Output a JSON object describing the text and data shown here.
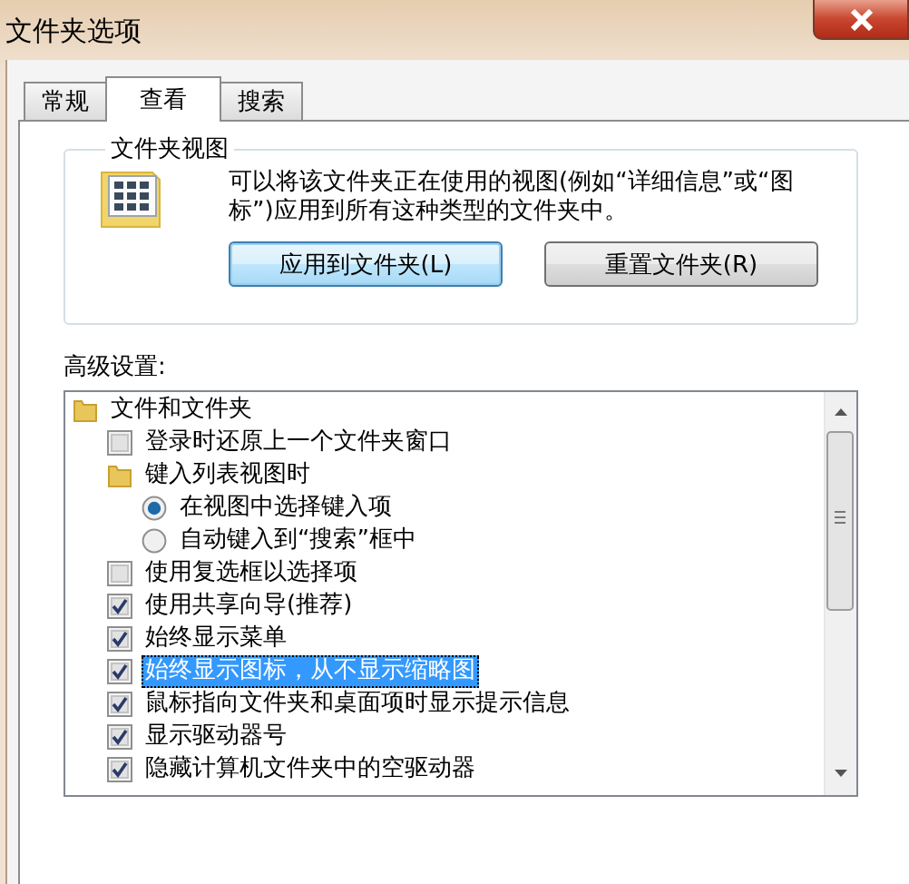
{
  "window": {
    "title": "文件夹选项"
  },
  "tabs": [
    {
      "label": "常规",
      "selected": false
    },
    {
      "label": "查看",
      "selected": true
    },
    {
      "label": "搜索",
      "selected": false
    }
  ],
  "folder_views": {
    "title": "文件夹视图",
    "description": "可以将该文件夹正在使用的视图(例如“详细信息”或“图标”)应用到所有这种类型的文件夹中。",
    "buttons": [
      {
        "label": "应用到文件夹(L)",
        "default": true
      },
      {
        "label": "重置文件夹(R)",
        "default": false
      }
    ]
  },
  "advanced": {
    "label": "高级设置:",
    "items": [
      {
        "kind": "folder",
        "label": "文件和文件夹",
        "selected": false,
        "children": [
          {
            "kind": "checkbox",
            "label": "登录时还原上一个文件夹窗口",
            "checked": false,
            "selected": false
          },
          {
            "kind": "folder",
            "label": "键入列表视图时",
            "selected": false,
            "children": [
              {
                "kind": "radio",
                "label": "在视图中选择键入项",
                "checked": true,
                "selected": false
              },
              {
                "kind": "radio",
                "label": "自动键入到“搜索”框中",
                "checked": false,
                "selected": false
              }
            ]
          },
          {
            "kind": "checkbox",
            "label": "使用复选框以选择项",
            "checked": false,
            "selected": false
          },
          {
            "kind": "checkbox",
            "label": "使用共享向导(推荐)",
            "checked": true,
            "selected": false
          },
          {
            "kind": "checkbox",
            "label": "始终显示菜单",
            "checked": true,
            "selected": false
          },
          {
            "kind": "checkbox",
            "label": "始终显示图标，从不显示缩略图",
            "checked": true,
            "selected": true
          },
          {
            "kind": "checkbox",
            "label": "鼠标指向文件夹和桌面项时显示提示信息",
            "checked": true,
            "selected": false
          },
          {
            "kind": "checkbox",
            "label": "显示驱动器号",
            "checked": true,
            "selected": false
          },
          {
            "kind": "checkbox",
            "label": "隐藏计算机文件夹中的空驱动器",
            "checked": true,
            "selected": false
          }
        ]
      }
    ]
  }
}
